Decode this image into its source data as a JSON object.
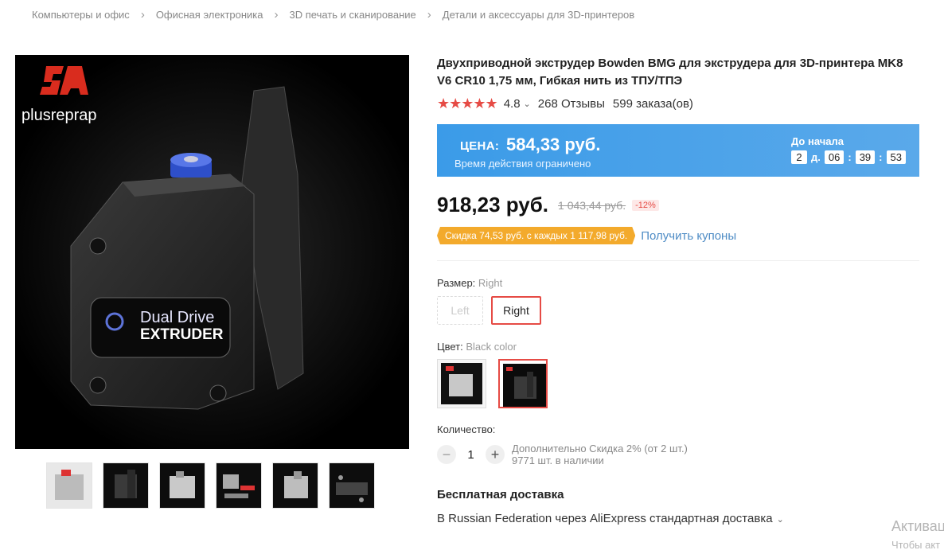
{
  "breadcrumb": [
    "Компьютеры и офис",
    "Офисная электроника",
    "3D печать и сканирование",
    "Детали и аксессуары для 3D-принтеров"
  ],
  "product": {
    "title": "Двухприводной экструдер Bowden BMG для экструдера для 3D-принтера MK8 V6 CR10 1,75 мм, Гибкая нить из ТПУ/ТПЭ",
    "image_logo": "plusreprap",
    "image_label_1": "Dual Drive",
    "image_label_2": "EXTRUDER"
  },
  "rating": {
    "stars": "★★★★★",
    "value": "4.8",
    "reviews": "268 Отзывы",
    "orders": "599 заказа(ов)"
  },
  "promo": {
    "label": "ЦЕНА:",
    "price": "584,33 руб.",
    "limited": "Время действия ограничено",
    "until": "До начала",
    "days": "2",
    "days_unit": "д.",
    "hours": "06",
    "minutes": "39",
    "seconds": "53",
    "bg_color": "#3b9be8"
  },
  "price": {
    "current": "918,23 руб.",
    "old": "1 043,44 руб.",
    "discount": "-12%"
  },
  "coupon": {
    "text": "Скидка 74,53 руб. с каждых 1 117,98 руб.",
    "link": "Получить купоны"
  },
  "size": {
    "label": "Размер:",
    "selected": "Right",
    "options": [
      "Left",
      "Right"
    ]
  },
  "color": {
    "label": "Цвет:",
    "selected": "Black color"
  },
  "quantity": {
    "label": "Количество:",
    "minus": "−",
    "value": "1",
    "plus": "+",
    "extra": "Дополнительно Скидка 2% (от 2 шт.)",
    "stock": "9771 шт. в наличии"
  },
  "shipping": {
    "title": "Бесплатная доставка",
    "detail": "В Russian Federation через AliExpress стандартная доставка"
  },
  "watermark": {
    "line1": "Активаци",
    "line2": "Чтобы акт"
  },
  "icons": {
    "breadcrumb_sep": "chevron-right-icon",
    "dropdown": "chevron-down-icon",
    "star": "star-icon"
  },
  "colors": {
    "accent": "#e64b45",
    "link": "#4e8cc5",
    "coupon": "#f3aa2c"
  }
}
